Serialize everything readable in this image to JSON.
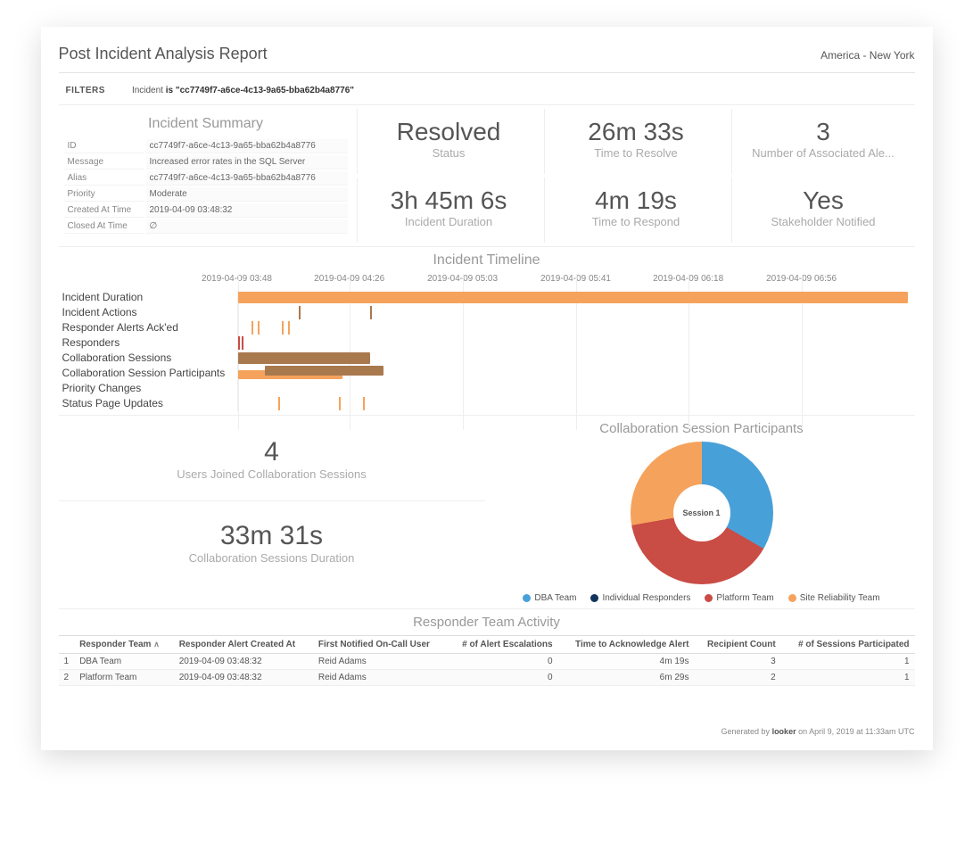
{
  "header": {
    "title": "Post Incident Analysis Report",
    "timezone": "America - New York"
  },
  "filters": {
    "label": "FILTERS",
    "prefix": "Incident ",
    "text": "is \"cc7749f7-a6ce-4c13-9a65-bba62b4a8776\""
  },
  "summary": {
    "title": "Incident Summary",
    "rows": [
      {
        "k": "ID",
        "v": "cc7749f7-a6ce-4c13-9a65-bba62b4a8776"
      },
      {
        "k": "Message",
        "v": "Increased error rates in the SQL Server"
      },
      {
        "k": "Alias",
        "v": "cc7749f7-a6ce-4c13-9a65-bba62b4a8776"
      },
      {
        "k": "Priority",
        "v": "Moderate"
      },
      {
        "k": "Created At Time",
        "v": "2019-04-09 03:48:32"
      },
      {
        "k": "Closed At Time",
        "v": "∅"
      }
    ]
  },
  "metrics": [
    {
      "value": "Resolved",
      "label": "Status"
    },
    {
      "value": "26m 33s",
      "label": "Time to Resolve"
    },
    {
      "value": "3",
      "label": "Number of Associated Ale..."
    },
    {
      "value": "3h 45m 6s",
      "label": "Incident Duration"
    },
    {
      "value": "4m 19s",
      "label": "Time to Respond"
    },
    {
      "value": "Yes",
      "label": "Stakeholder Notified"
    }
  ],
  "timeline": {
    "title": "Incident Timeline",
    "axis": [
      "2019-04-09 03:48",
      "2019-04-09 04:26",
      "2019-04-09 05:03",
      "2019-04-09 05:41",
      "2019-04-09 06:18",
      "2019-04-09 06:56"
    ],
    "rows": [
      "Incident Duration",
      "Incident Actions",
      "Responder Alerts Ack'ed",
      "Responders",
      "Collaboration Sessions",
      "Collaboration Session Participants",
      "Priority Changes",
      "Status Page Updates"
    ]
  },
  "mid": {
    "users_value": "4",
    "users_label": "Users Joined Collaboration Sessions",
    "dur_value": "33m 31s",
    "dur_label": "Collaboration Sessions Duration",
    "donut_title": "Collaboration Session Participants",
    "donut_center": "Session 1",
    "legend": [
      {
        "label": "DBA Team",
        "color": "#48a0d8"
      },
      {
        "label": "Individual Responders",
        "color": "#10345d"
      },
      {
        "label": "Platform Team",
        "color": "#c94c45"
      },
      {
        "label": "Site Reliability Team",
        "color": "#f5a35c"
      }
    ]
  },
  "table": {
    "title": "Responder Team Activity",
    "columns": [
      "Responder Team",
      "Responder Alert Created At",
      "First Notified On-Call User",
      "# of Alert Escalations",
      "Time to Acknowledge Alert",
      "Recipient Count",
      "# of Sessions Participated"
    ],
    "rows": [
      {
        "n": "1",
        "team": "DBA Team",
        "created": "2019-04-09 03:48:32",
        "user": "Reid Adams",
        "esc": "0",
        "tta": "4m 19s",
        "rc": "3",
        "sp": "1"
      },
      {
        "n": "2",
        "team": "Platform Team",
        "created": "2019-04-09 03:48:32",
        "user": "Reid Adams",
        "esc": "0",
        "tta": "6m 29s",
        "rc": "2",
        "sp": "1"
      }
    ]
  },
  "footer": {
    "prefix": "Generated by ",
    "brand": "looker",
    "suffix": " on April 9, 2019 at 11:33am UTC"
  },
  "chart_data": [
    {
      "type": "bar",
      "name": "Incident Timeline (Gantt)",
      "x_axis_ticks": [
        "2019-04-09 03:48",
        "2019-04-09 04:26",
        "2019-04-09 05:03",
        "2019-04-09 05:41",
        "2019-04-09 06:18",
        "2019-04-09 06:56"
      ],
      "tracks": [
        {
          "label": "Incident Duration",
          "spans": [
            {
              "start": "2019-04-09 03:48",
              "end": "2019-04-09 07:33",
              "color": "orange"
            }
          ]
        },
        {
          "label": "Incident Actions",
          "events": [
            "2019-04-09 04:09",
            "2019-04-09 04:33"
          ],
          "color": "brown"
        },
        {
          "label": "Responder Alerts Ack'ed",
          "events": [
            "2019-04-09 03:53",
            "2019-04-09 03:55",
            "2019-04-09 04:03",
            "2019-04-09 04:05"
          ],
          "color": "orange"
        },
        {
          "label": "Responders",
          "events": [
            "2019-04-09 03:48",
            "2019-04-09 03:48"
          ],
          "color": "red"
        },
        {
          "label": "Collaboration Sessions",
          "spans": [
            {
              "start": "2019-04-09 03:48",
              "end": "2019-04-09 04:33",
              "color": "brown"
            }
          ]
        },
        {
          "label": "Collaboration Session Participants",
          "spans": [
            {
              "start": "2019-04-09 03:48",
              "end": "2019-04-09 04:24",
              "color": "orange"
            },
            {
              "start": "2019-04-09 03:58",
              "end": "2019-04-09 04:38",
              "color": "brown"
            }
          ]
        },
        {
          "label": "Priority Changes",
          "events": []
        },
        {
          "label": "Status Page Updates",
          "events": [
            "2019-04-09 04:02",
            "2019-04-09 04:22",
            "2019-04-09 04:30"
          ],
          "color": "orange"
        }
      ]
    },
    {
      "type": "pie",
      "name": "Collaboration Session Participants",
      "center_label": "Session 1",
      "series": [
        {
          "name": "DBA Team",
          "value": 33,
          "color": "#48a0d8"
        },
        {
          "name": "Individual Responders",
          "value": 0,
          "color": "#10345d"
        },
        {
          "name": "Platform Team",
          "value": 39,
          "color": "#c94c45"
        },
        {
          "name": "Site Reliability Team",
          "value": 28,
          "color": "#f5a35c"
        }
      ]
    }
  ]
}
